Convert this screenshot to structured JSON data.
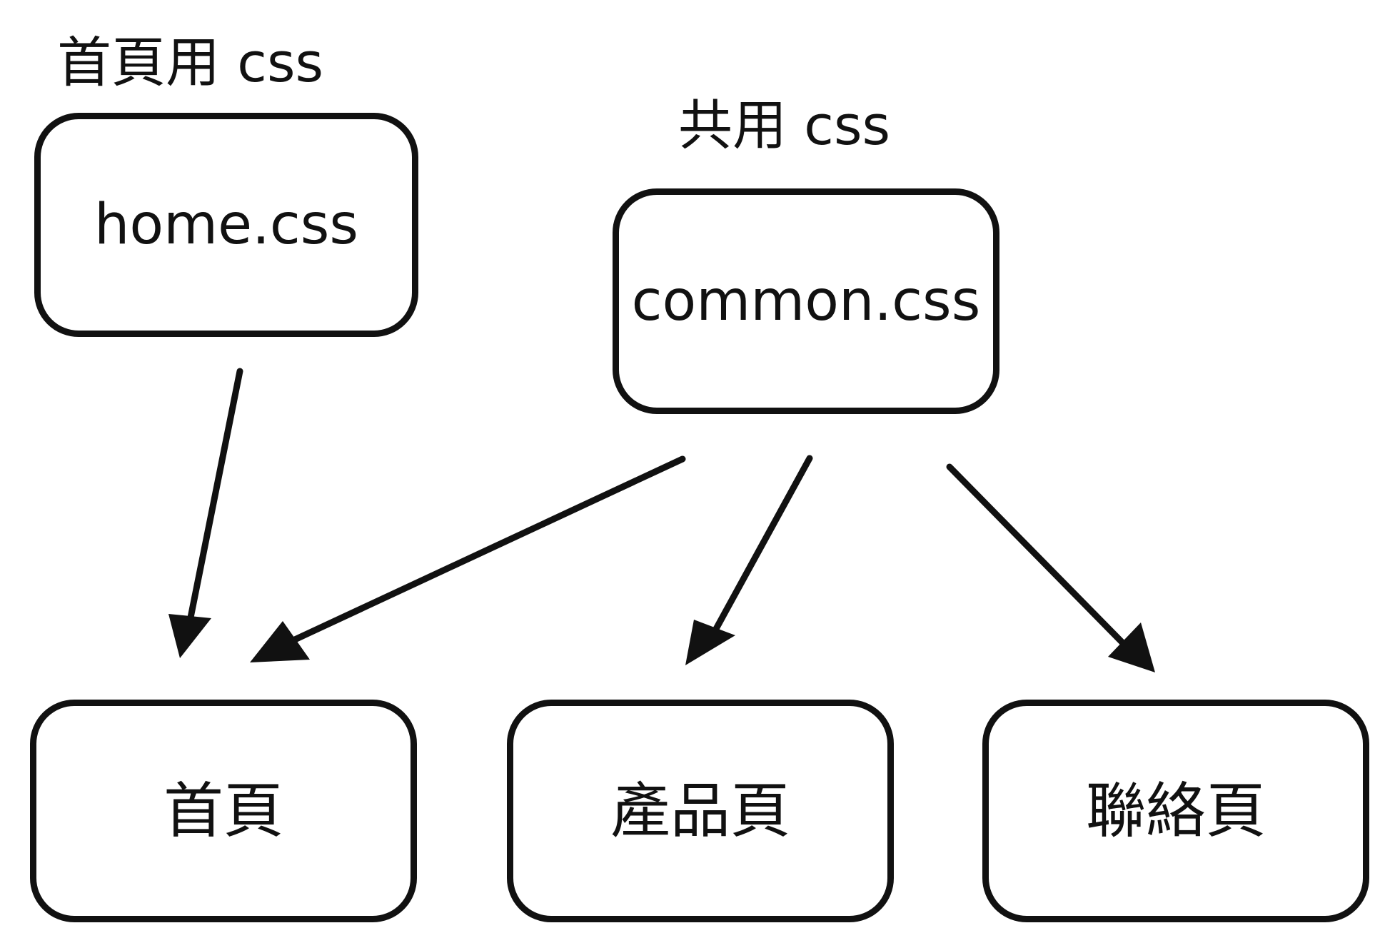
{
  "labels": {
    "home_css_label": "首頁用 css",
    "common_css_label": "共用 css"
  },
  "nodes": {
    "home_css": "home.css",
    "common_css": "common.css",
    "home_page": "首頁",
    "product_page": "產品頁",
    "contact_page": "聯絡頁"
  },
  "edges": [
    {
      "from": "home.css",
      "to": "首頁"
    },
    {
      "from": "common.css",
      "to": "首頁"
    },
    {
      "from": "common.css",
      "to": "產品頁"
    },
    {
      "from": "common.css",
      "to": "聯絡頁"
    }
  ],
  "colors": {
    "stroke": "#111111",
    "background": "#ffffff"
  }
}
